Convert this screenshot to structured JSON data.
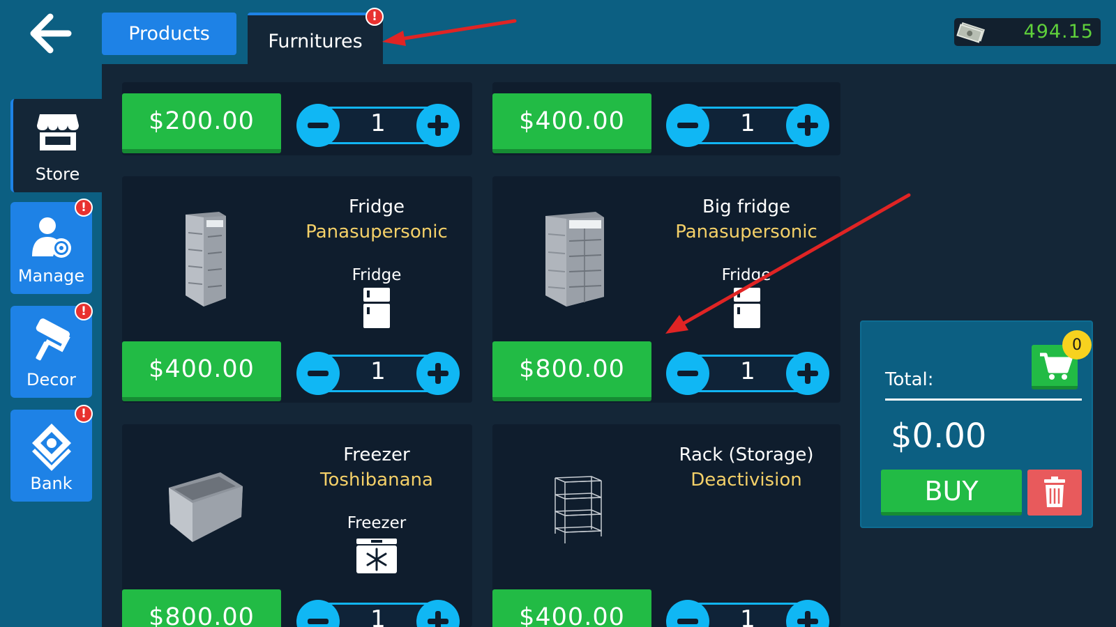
{
  "header": {
    "back_icon": "arrow-left-icon",
    "tabs": [
      {
        "label": "Products",
        "active": false
      },
      {
        "label": "Furnitures",
        "active": true,
        "alert": "!"
      }
    ],
    "money": {
      "icon": "money-bills-icon",
      "value": "494.15"
    }
  },
  "sidebar": {
    "items": [
      {
        "label": "Store",
        "icon": "store-icon",
        "active": true
      },
      {
        "label": "Manage",
        "icon": "manage-user-gear-icon",
        "alert": "!"
      },
      {
        "label": "Decor",
        "icon": "paint-roller-icon",
        "alert": "!"
      },
      {
        "label": "Bank",
        "icon": "bank-money-icon",
        "alert": "!"
      }
    ]
  },
  "cards": [
    {
      "price": "$200.00",
      "quantity": "1"
    },
    {
      "price": "$400.00",
      "quantity": "1"
    },
    {
      "name": "Fridge",
      "brand": "Panasupersonic",
      "category": "Fridge",
      "category_icon": "fridge-icon",
      "price": "$400.00",
      "quantity": "1"
    },
    {
      "name": "Big fridge",
      "brand": "Panasupersonic",
      "category": "Fridge",
      "category_icon": "fridge-icon",
      "price": "$800.00",
      "quantity": "1"
    },
    {
      "name": "Freezer",
      "brand": "Toshibanana",
      "category": "Freezer",
      "category_icon": "freezer-snowflake-icon",
      "price": "$800.00",
      "quantity": "1"
    },
    {
      "name": "Rack (Storage)",
      "brand": "Deactivision",
      "price": "$400.00",
      "quantity": "1"
    }
  ],
  "cart": {
    "total_label": "Total:",
    "total_value": "$0.00",
    "count": "0",
    "buy_label": "BUY",
    "cart_icon": "shopping-cart-icon",
    "trash_icon": "trash-icon"
  },
  "colors": {
    "background": "#0c5f82",
    "panel": "#142637",
    "card": "#0f1d2d",
    "price_green": "#22bb45",
    "qty_blue": "#10b7f4",
    "brand_yellow": "#f4d068",
    "money_green": "#5fd13b",
    "alert_red": "#e8312f",
    "tab_blue": "#1e82e6",
    "annotation_red": "#e02424"
  }
}
